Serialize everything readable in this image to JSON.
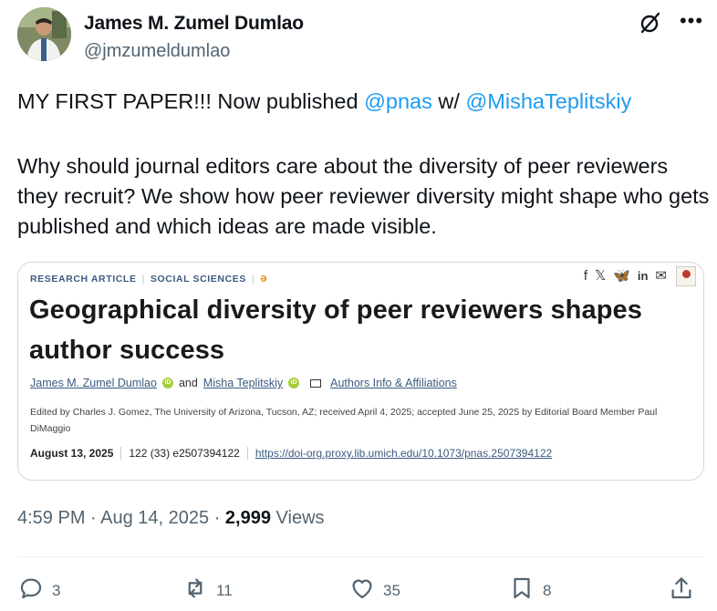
{
  "author": {
    "name": "James M. Zumel Dumlao",
    "handle": "@jmzumeldumlao"
  },
  "icons": {
    "grok": "grok-icon",
    "more": "more-icon"
  },
  "tweet": {
    "line1_pre": "MY FIRST PAPER!!! Now published ",
    "mention1": "@pnas",
    "line1_mid": " w/ ",
    "mention2": "@MishaTeplitskiy",
    "para2": "Why should journal editors care about the diversity of peer reviewers they recruit? We show how peer reviewer diversity might shape who gets published and which ideas are made visible."
  },
  "card": {
    "tag1": "RESEARCH ARTICLE",
    "tag2": "SOCIAL SCIENCES",
    "share": [
      "f",
      "𝕏",
      "🦋",
      "in",
      "✉"
    ],
    "title": "Geographical diversity of peer reviewers shapes author success",
    "author1": "James M. Zumel Dumlao",
    "and": "and",
    "author2": "Misha Teplitskiy",
    "affiliations": "Authors Info & Affiliations",
    "edited": "Edited by Charles J. Gomez, The University of Arizona, Tucson, AZ; received April 4, 2025; accepted June 25, 2025 by Editorial Board Member Paul DiMaggio",
    "date": "August 13, 2025",
    "volume": "122 (33) e2507394122",
    "doi": "https://doi-org.proxy.lib.umich.edu/10.1073/pnas.2507394122"
  },
  "meta": {
    "time": "4:59 PM · Aug 14, 2025 · ",
    "views_count": "2,999",
    "views_label": " Views"
  },
  "actions": {
    "replies": "3",
    "reposts": "11",
    "likes": "35",
    "bookmarks": "8"
  },
  "colors": {
    "accent": "#1d9bf0",
    "muted": "#536471",
    "text": "#0f1419"
  }
}
